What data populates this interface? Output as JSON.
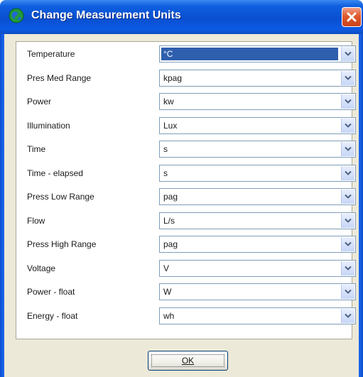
{
  "window": {
    "title": "Change Measurement Units",
    "app_icon": "globe-icon",
    "close_icon": "close-icon"
  },
  "units": [
    {
      "label": "Temperature",
      "value": "°C",
      "selected": true
    },
    {
      "label": "Pres Med Range",
      "value": "kpag"
    },
    {
      "label": "Power",
      "value": "kw"
    },
    {
      "label": "Illumination",
      "value": "Lux"
    },
    {
      "label": "Time",
      "value": "s"
    },
    {
      "label": "Time - elapsed",
      "value": "s"
    },
    {
      "label": "Press Low Range",
      "value": "pag"
    },
    {
      "label": "Flow",
      "value": "L/s"
    },
    {
      "label": "Press High Range",
      "value": "pag"
    },
    {
      "label": "Voltage",
      "value": "V"
    },
    {
      "label": "Power - float",
      "value": "W"
    },
    {
      "label": "Energy - float",
      "value": "wh"
    }
  ],
  "buttons": {
    "ok_label": "OK"
  },
  "colors": {
    "titlebar": "#0a4fd0",
    "selection": "#2e5fae",
    "dialog_face": "#ece9d8",
    "close_button": "#e05a2c"
  }
}
